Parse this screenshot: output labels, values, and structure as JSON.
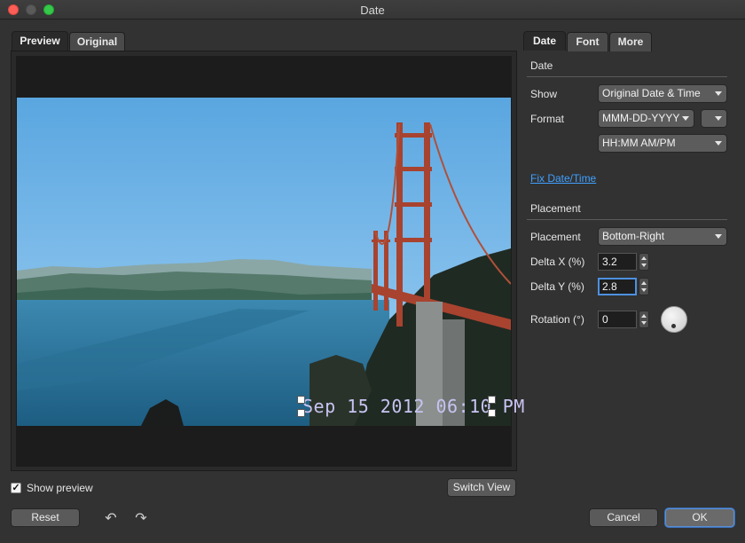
{
  "window": {
    "title": "Date"
  },
  "preview_tabs": [
    {
      "label": "Preview",
      "active": true
    },
    {
      "label": "Original",
      "active": false
    }
  ],
  "preview": {
    "date_stamp": "Sep 15 2012 06:10 PM",
    "show_preview_label": "Show preview",
    "show_preview_checked": true,
    "switch_view_label": "Switch View"
  },
  "settings_tabs": [
    {
      "label": "Date",
      "active": true
    },
    {
      "label": "Font",
      "active": false
    },
    {
      "label": "More",
      "active": false
    }
  ],
  "date_section": {
    "title": "Date",
    "show_label": "Show",
    "show_value": "Original Date & Time",
    "format_label": "Format",
    "format_date_value": "MMM-DD-YYYY",
    "format_extra_value": "",
    "format_time_value": "HH:MM AM/PM",
    "fix_link": "Fix Date/Time"
  },
  "placement_section": {
    "title": "Placement",
    "placement_label": "Placement",
    "placement_value": "Bottom-Right",
    "delta_x_label": "Delta X (%)",
    "delta_x_value": "3.2",
    "delta_y_label": "Delta Y (%)",
    "delta_y_value": "2.8",
    "rotation_label": "Rotation (°)",
    "rotation_value": "0"
  },
  "footer": {
    "reset_label": "Reset",
    "undo_icon": "undo-arrow",
    "redo_icon": "redo-arrow",
    "cancel_label": "Cancel",
    "ok_label": "OK"
  },
  "colors": {
    "accent": "#4d90e0",
    "link": "#3fa0ff",
    "date_stamp": "#c8c3f2"
  }
}
